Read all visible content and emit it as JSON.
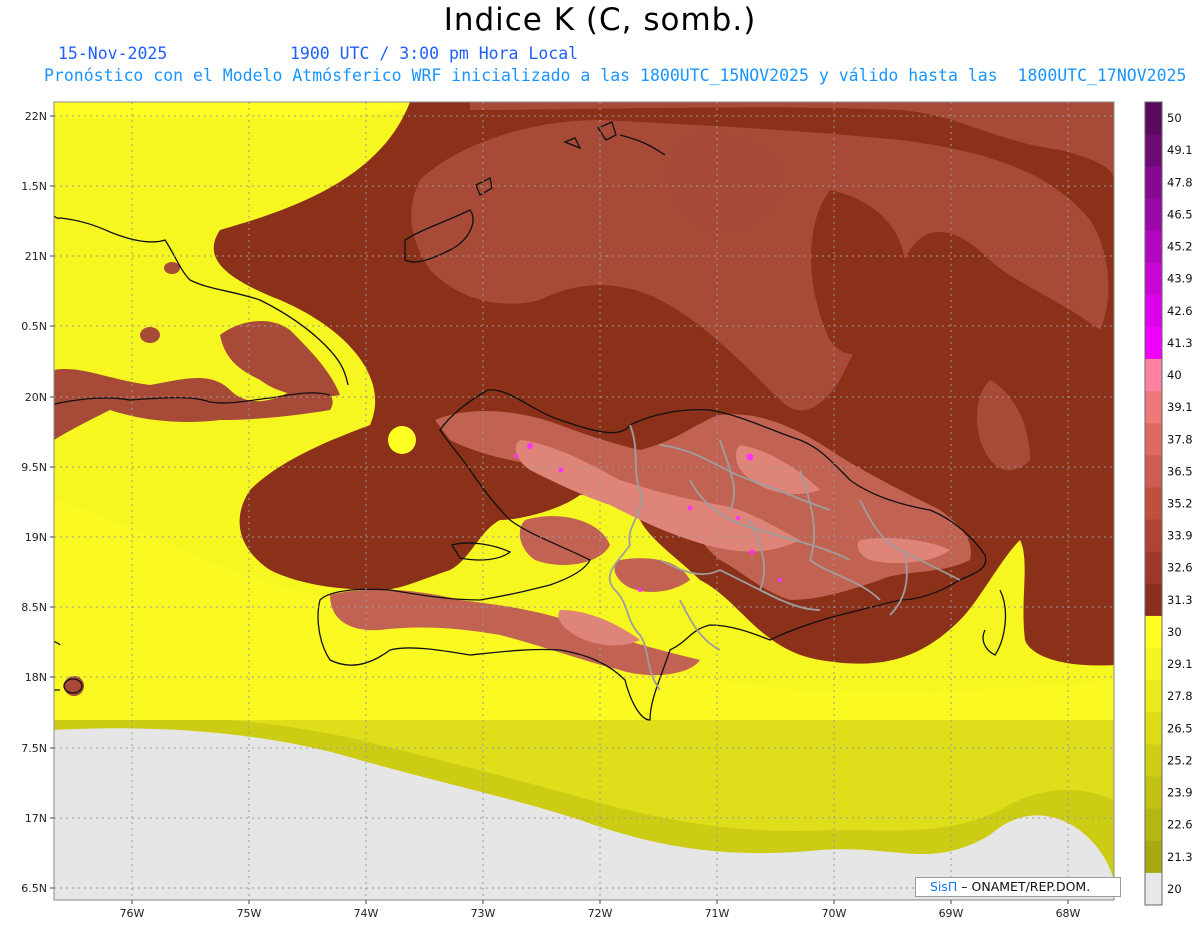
{
  "header": {
    "title": "Indice K (C, somb.)",
    "date": "15-Nov-2025",
    "time": "1900 UTC / 3:00 pm Hora Local",
    "description": "Pronóstico con el Modelo Atmósferico WRF inicializado a las 1800UTC_15NOV2025 y válido hasta las  1800UTC_17NOV2025"
  },
  "axes": {
    "lat_labels": [
      "22N",
      "1.5N",
      "21N",
      "0.5N",
      "20N",
      "9.5N",
      "19N",
      "8.5N",
      "18N",
      "7.5N",
      "17N",
      "6.5N"
    ],
    "lon_labels": [
      "76W",
      "75W",
      "74W",
      "73W",
      "72W",
      "71W",
      "70W",
      "69W",
      "68W"
    ]
  },
  "colorbar": {
    "labels": [
      "50",
      "49.1",
      "47.8",
      "46.5",
      "45.2",
      "43.9",
      "42.6",
      "41.3",
      "40",
      "39.1",
      "37.8",
      "36.5",
      "35.2",
      "33.9",
      "32.6",
      "31.3",
      "30",
      "29.1",
      "27.8",
      "26.5",
      "25.2",
      "23.9",
      "22.6",
      "21.3",
      "20"
    ],
    "colors": [
      "#5a0a5e",
      "#6e0a76",
      "#85088f",
      "#9c08a8",
      "#b306c0",
      "#c904d6",
      "#dd00eb",
      "#f000ff",
      "#ff80a0",
      "#f07878",
      "#e06a60",
      "#cf5c50",
      "#bf5040",
      "#b04434",
      "#a0382a",
      "#8b2e1e",
      "#ffff22",
      "#f5f520",
      "#eaea1c",
      "#dcdc18",
      "#cece16",
      "#c2c214",
      "#b6b612",
      "#a8a810",
      "#e8e8e8"
    ]
  },
  "credit": {
    "logo": "SisΠ",
    "text": " – ONAMET/REP.DOM."
  },
  "colors": {
    "background_land_ocean_low": "#e6e6e6",
    "k_30": "#8b3019",
    "k_31": "#a74a38",
    "k_33": "#c26252",
    "k_35": "#de8478",
    "k_39": "#f9a39a",
    "k_41": "#ff33ff",
    "k_27": "#eaea22",
    "k_29": "#ffff24",
    "coast": "#111111",
    "border": "#9e9e9e"
  }
}
